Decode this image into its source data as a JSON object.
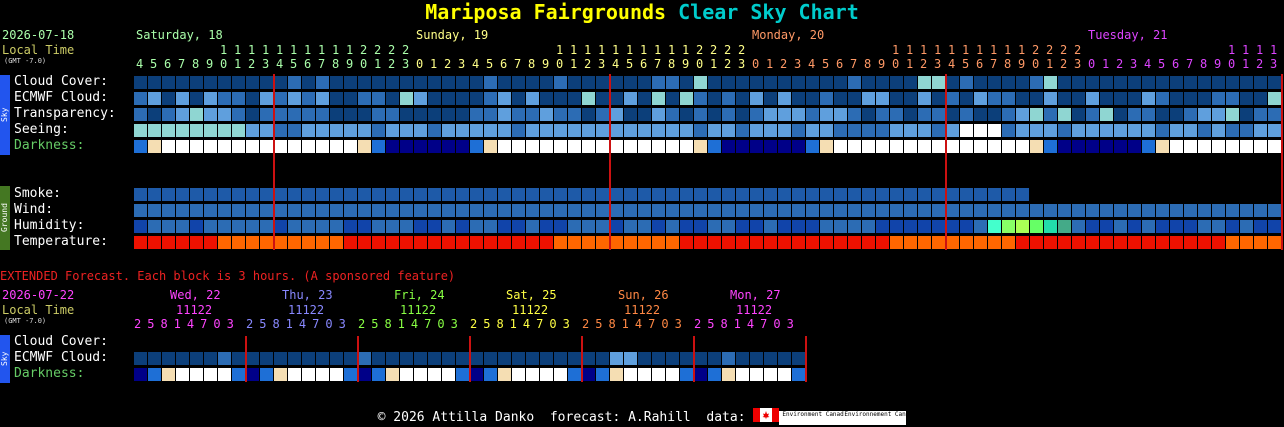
{
  "title": {
    "site": "Mariposa Fairgrounds",
    "chart": "Clear Sky Chart"
  },
  "main": {
    "date": "2026-07-18",
    "local_time_label": "Local Time",
    "gmt_label": "(GMT -7.0)",
    "days": [
      {
        "label": "Saturday, 18",
        "color": "#aaffaa"
      },
      {
        "label": "Sunday, 19",
        "color": "#ffff88"
      },
      {
        "label": "Monday, 20",
        "color": "#ff9966"
      },
      {
        "label": "Tuesday, 21",
        "color": "#dd44ff"
      }
    ],
    "hours_row1": "1111111222201234567890123456789012345678901234567890123456789012345678901234567890123456789012345678901234567890123456789012345678901234567890",
    "hours_row2": "4567890123012345678901234567890123456789012345678901234567890123456789012345678901234567890123",
    "hour_tens": [
      "            1 1 1 1 1 1 1 2 2 2 2",
      "1 1 1 1 1 1 1 1 1 1 2 2 2 2",
      "1 1 1 1 1 1 1 1 1 1 2 2 2 2",
      "1 1 1 1 1 1 1 1 1 1 2 2 2 2"
    ],
    "hour_ones_text": "4567890123012345678901234567890123012345678901234567890123012345678901234567890123",
    "sky_tag": "Sky",
    "ground_tag": "Ground",
    "rows": [
      {
        "name": "cloud_cover",
        "label": "Cloud Cover:"
      },
      {
        "name": "ecmwf_cloud",
        "label": "ECMWF Cloud:"
      },
      {
        "name": "transparency",
        "label": "Transparency:"
      },
      {
        "name": "seeing",
        "label": "Seeing:"
      },
      {
        "name": "darkness",
        "label": "Darkness:",
        "color": "#66cc66"
      },
      {
        "name": "smoke",
        "label": "Smoke:"
      },
      {
        "name": "wind",
        "label": "Wind:"
      },
      {
        "name": "humidity",
        "label": "Humidity:"
      },
      {
        "name": "temperature",
        "label": "Temperature:"
      }
    ]
  },
  "extended": {
    "notice": "EXTENDED Forecast. Each block is 3 hours. (A sponsored feature)",
    "date": "2026-07-22",
    "local_time_label": "Local Time",
    "gmt_label": "(GMT -7.0)",
    "days": [
      {
        "label": "Wed, 22",
        "color": "#ff44ff",
        "tens": "11122",
        "ones": "25814703"
      },
      {
        "label": "Thu, 23",
        "color": "#8888ff",
        "tens": "11122",
        "ones": "25814703"
      },
      {
        "label": "Fri, 24",
        "color": "#88ff44",
        "tens": "11122",
        "ones": "25814703"
      },
      {
        "label": "Sat, 25",
        "color": "#ffff44",
        "tens": "11122",
        "ones": "25814703"
      },
      {
        "label": "Sun, 26",
        "color": "#ff8844",
        "tens": "11122",
        "ones": "25814703"
      },
      {
        "label": "Mon, 27",
        "color": "#ff44ff",
        "tens": "11122",
        "ones": "25814703"
      }
    ],
    "rows": [
      {
        "name": "cloud_cover",
        "label": "Cloud Cover:"
      },
      {
        "name": "ecmwf_cloud",
        "label": "ECMWF Cloud:"
      },
      {
        "name": "darkness",
        "label": "Darkness:",
        "color": "#66cc66"
      }
    ]
  },
  "footer": {
    "copyright": "© 2026 Attilla Danko",
    "forecast": "forecast: A.Rahill",
    "data_label": "data:",
    "logo_text_1": "Environment Canada",
    "logo_text_2": "Environnement Canada"
  },
  "colors": {
    "dark_blue": "#0c3f7a",
    "mid_blue": "#2c6cb4",
    "light_blue": "#5f9fdd",
    "pale_blue": "#9ec7f0",
    "teal": "#8fd6d2",
    "white": "#ffffff",
    "divider": "#cc1111"
  }
}
